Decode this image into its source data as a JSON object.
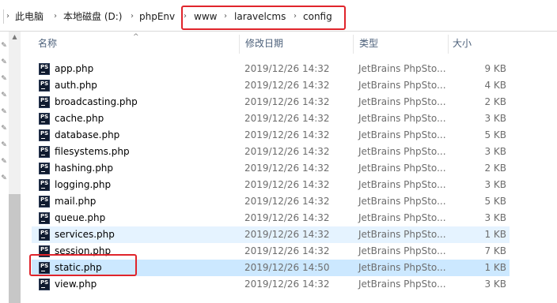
{
  "breadcrumb": {
    "items": [
      "此电脑",
      "本地磁盘 (D:)",
      "phpEnv",
      "www",
      "laravelcms",
      "config"
    ],
    "separator": "›"
  },
  "columns": {
    "name": "名称",
    "modified": "修改日期",
    "type": "类型",
    "size": "大小"
  },
  "files": [
    {
      "name": "app.php",
      "modified": "2019/12/26 14:32",
      "type": "JetBrains PhpSto...",
      "size": "9 KB"
    },
    {
      "name": "auth.php",
      "modified": "2019/12/26 14:32",
      "type": "JetBrains PhpSto...",
      "size": "4 KB"
    },
    {
      "name": "broadcasting.php",
      "modified": "2019/12/26 14:32",
      "type": "JetBrains PhpSto...",
      "size": "2 KB"
    },
    {
      "name": "cache.php",
      "modified": "2019/12/26 14:32",
      "type": "JetBrains PhpSto...",
      "size": "3 KB"
    },
    {
      "name": "database.php",
      "modified": "2019/12/26 14:32",
      "type": "JetBrains PhpSto...",
      "size": "5 KB"
    },
    {
      "name": "filesystems.php",
      "modified": "2019/12/26 14:32",
      "type": "JetBrains PhpSto...",
      "size": "3 KB"
    },
    {
      "name": "hashing.php",
      "modified": "2019/12/26 14:32",
      "type": "JetBrains PhpSto...",
      "size": "2 KB"
    },
    {
      "name": "logging.php",
      "modified": "2019/12/26 14:32",
      "type": "JetBrains PhpSto...",
      "size": "3 KB"
    },
    {
      "name": "mail.php",
      "modified": "2019/12/26 14:32",
      "type": "JetBrains PhpSto...",
      "size": "5 KB"
    },
    {
      "name": "queue.php",
      "modified": "2019/12/26 14:32",
      "type": "JetBrains PhpSto...",
      "size": "3 KB"
    },
    {
      "name": "services.php",
      "modified": "2019/12/26 14:32",
      "type": "JetBrains PhpSto...",
      "size": "1 KB"
    },
    {
      "name": "session.php",
      "modified": "2019/12/26 14:32",
      "type": "JetBrains PhpSto...",
      "size": "7 KB"
    },
    {
      "name": "static.php",
      "modified": "2019/12/26 14:50",
      "type": "JetBrains PhpSto...",
      "size": "1 KB"
    },
    {
      "name": "view.php",
      "modified": "2019/12/26 14:32",
      "type": "JetBrains PhpSto...",
      "size": "3 KB"
    }
  ],
  "file_icon": {
    "name": "phpstorm-file-icon",
    "label": "PS"
  },
  "state": {
    "hover_row": "services.php",
    "selected_row": "static.php"
  },
  "colors": {
    "highlight_box": "#e0242b",
    "selected": "#cce8ff",
    "hover": "#e5f3ff"
  }
}
